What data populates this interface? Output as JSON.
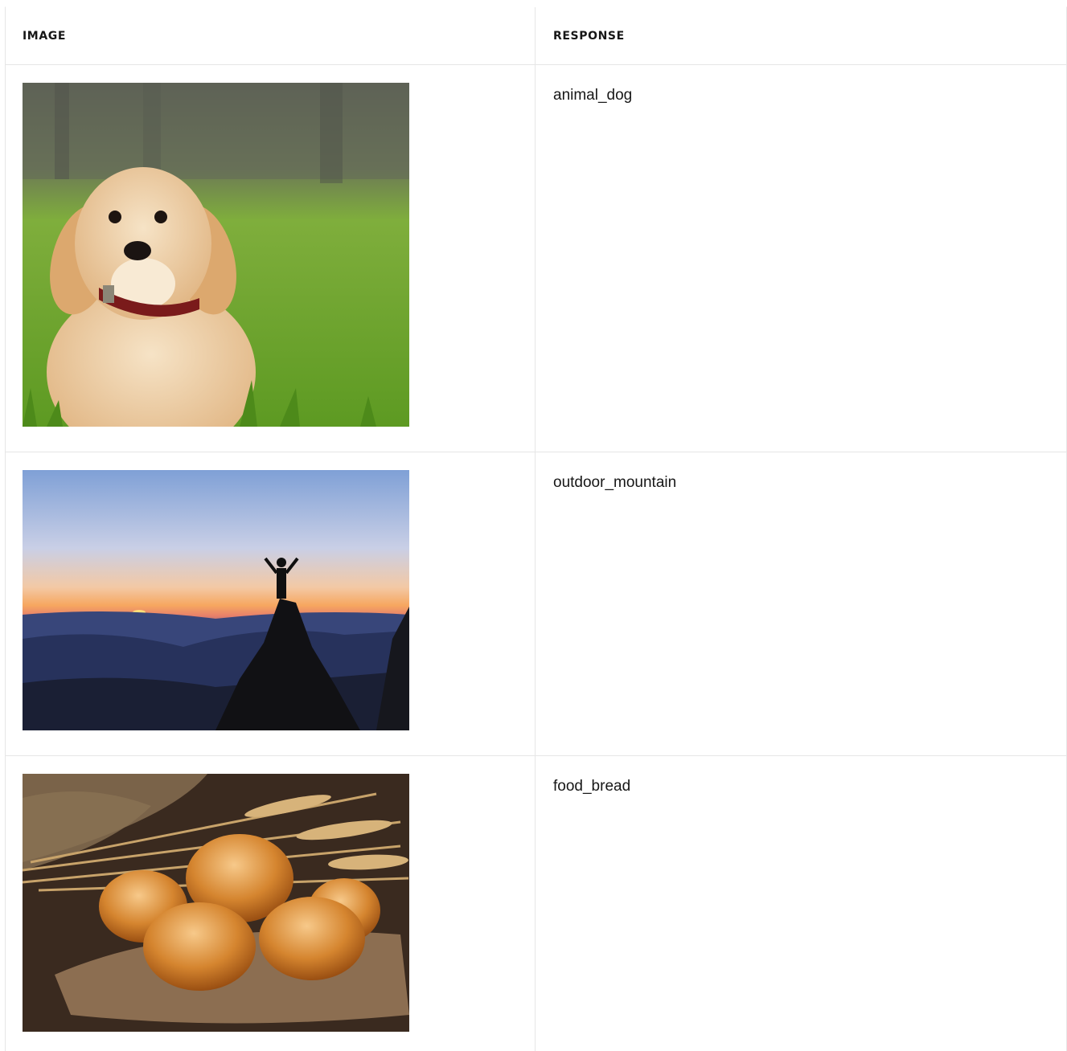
{
  "table": {
    "headers": {
      "image": "IMAGE",
      "response": "RESPONSE"
    },
    "rows": [
      {
        "image_subject": "puppy-photo",
        "response": "animal_dog"
      },
      {
        "image_subject": "mountain-sunset-photo",
        "response": "outdoor_mountain"
      },
      {
        "image_subject": "bread-rolls-photo",
        "response": "food_bread"
      }
    ]
  }
}
